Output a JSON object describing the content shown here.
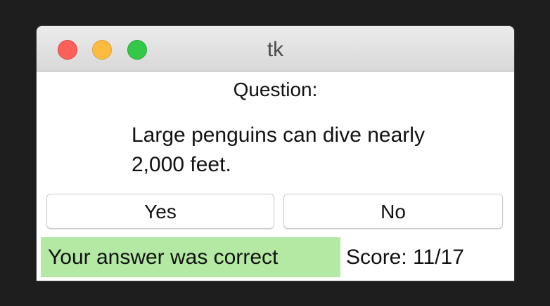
{
  "window": {
    "title": "tk"
  },
  "question": {
    "label": "Question:",
    "text": "Large penguins can dive nearly 2,000 feet."
  },
  "buttons": {
    "yes_label": "Yes",
    "no_label": "No"
  },
  "status": {
    "feedback": "Your answer was correct",
    "score": "Score: 11/17",
    "feedback_color": "#b3e9a3"
  },
  "colors": {
    "close": "#fc605b",
    "minimize": "#fdbc40",
    "maximize": "#34c84a",
    "backdrop": "#1e1e1e"
  },
  "icons": {
    "close": "close-icon",
    "minimize": "minimize-icon",
    "maximize": "maximize-icon"
  }
}
